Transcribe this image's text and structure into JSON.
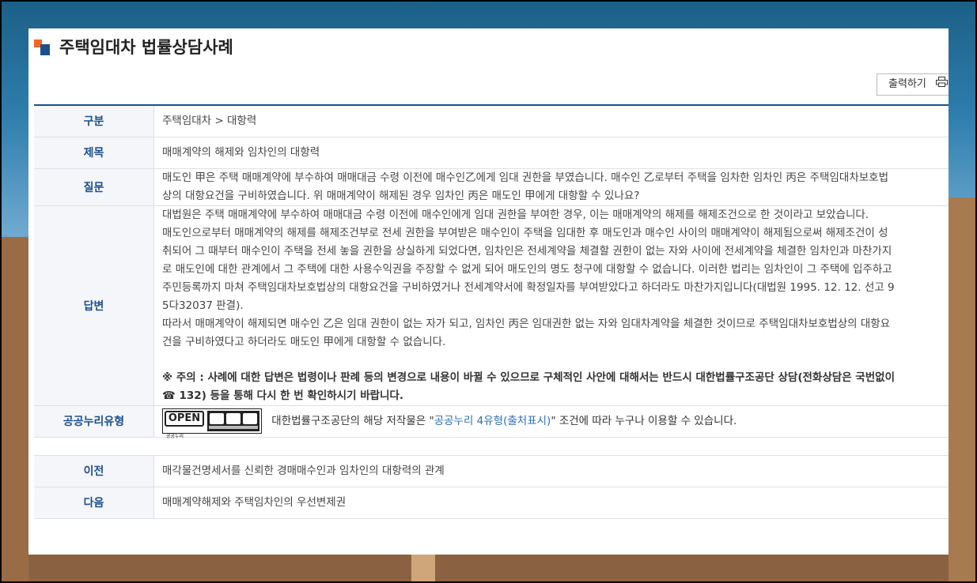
{
  "page": {
    "title": "주택임대차 법률상담사례",
    "print_label": "출력하기",
    "print_icon": "printer-icon"
  },
  "table": {
    "category": {
      "label": "구분",
      "value": "주택임대차 > 대항력"
    },
    "subject": {
      "label": "제목",
      "value": "매매계약의 해제와 임차인의 대항력"
    },
    "question": {
      "label": "질문",
      "lines": [
        "매도인 甲은 주택 매매계약에 부수하여 매매대금 수령 이전에 매수인乙에게 임대 권한을 부였습니다. 매수인 乙로부터 주택을 임차한 임차인 丙은 주택임대차보호법",
        "상의 대항요건을 구비하였습니다. 위 매매계약이 해제된 경우 임차인 丙은 매도인 甲에게 대항할 수 있나요?"
      ]
    },
    "answer": {
      "label": "답변",
      "lines": [
        "대법원은 주택 매매계약에 부수하여 매매대금 수령 이전에 매수인에게 임대 권한을 부여한 경우, 이는 매매계약의 해제를 해제조건으로 한 것이라고 보았습니다.",
        "매도인으로부터 매매계약의 해제를 해제조건부로 전세 권한을 부여받은 매수인이 주택을 임대한 후 매도인과 매수인 사이의 매매계약이 해제됨으로써 해제조건이 성",
        "취되어 그 때부터 매수인이 주택을 전세 놓을 권한을 상실하게 되었다면, 임차인은 전세계약을 체결할 권한이 없는 자와 사이에 전세계약을 체결한 임차인과 마찬가지",
        "로 매도인에 대한 관계에서 그 주택에 대한 사용수익권을 주장할 수 없게 되어 매도인의 명도 청구에 대항할 수 없습니다. 이러한 법리는 임차인이 그 주택에 입주하고",
        "주민등록까지 마쳐 주택임대차보호법상의 대항요건을 구비하였거나 전세계약서에 확정일자를 부여받았다고 하더라도 마찬가지입니다(대법원 1995. 12. 12. 선고 9",
        "5다32037 판결).",
        "따라서 매매계약이 해제되면 매수인 乙은 임대 권한이 없는 자가 되고, 임차인 丙은 임대권한 없는 자와 임대차계약을 체결한 것이므로 주택임대차보호법상의 대항요",
        "건을 구비하였다고 하더라도 매도인 甲에게 대항할 수 없습니다."
      ],
      "note_lines": [
        "※ 주의 : 사례에 대한 답변은 법령이나 판례 등의 변경으로 내용이 바뀔 수 있으므로 구체적인 사안에 대해서는 반드시 대한법률구조공단 상담(전화상담은 국번없이",
        "☎ 132) 등을 통해 다시 한 번 확인하시기 바랍니다."
      ]
    },
    "license": {
      "label": "공공누리유형",
      "badge_text": "OPEN",
      "badge_sub": "공공누리",
      "text_before": "대한법률구조공단의 해당 저작물은 \"",
      "link_text": "공공누리 4유형(출처표시)",
      "text_after": "\" 조건에 따라 누구나 이용할 수 있습니다."
    },
    "prev": {
      "label": "이전",
      "value": "매각물건명세서를 신뢰한 경매매수인과 임차인의 대항력의 관계"
    },
    "next": {
      "label": "다음",
      "value": "매매계약해제와 주택임차인의 우선변제권"
    }
  },
  "colors": {
    "accent_blue": "#1c4f8c",
    "accent_orange": "#f26522",
    "link": "#2a6fb8"
  }
}
